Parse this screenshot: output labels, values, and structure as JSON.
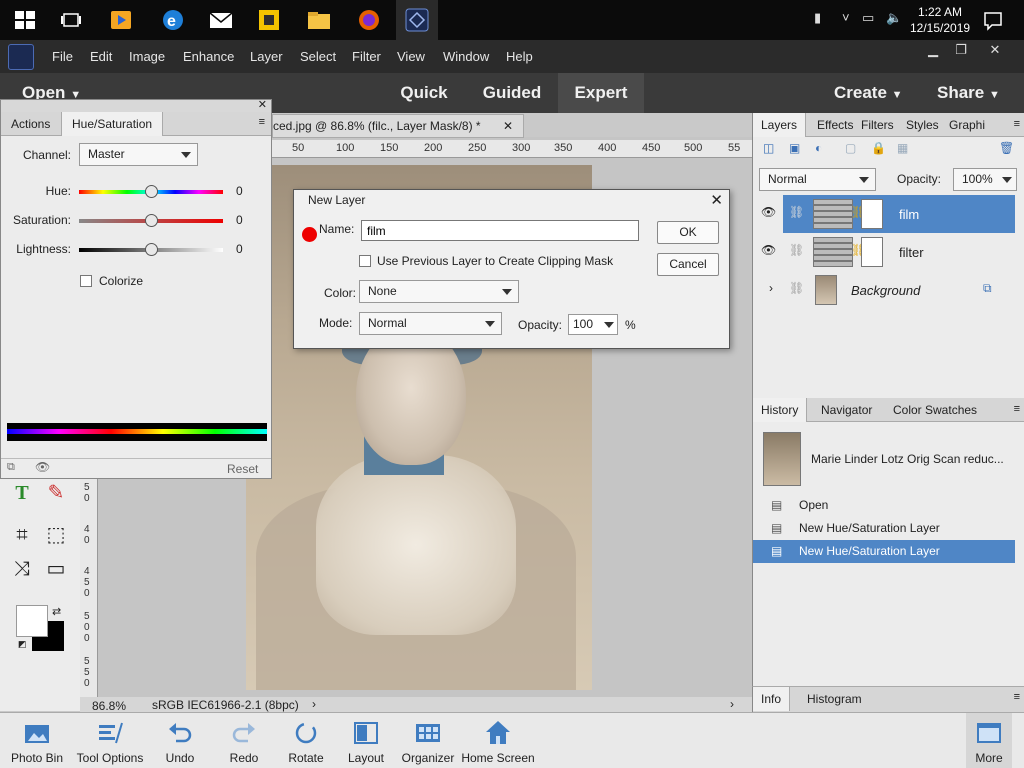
{
  "taskbar": {
    "time": "1:22 AM",
    "date": "12/15/2019"
  },
  "menubar": {
    "items": [
      "File",
      "Edit",
      "Image",
      "Enhance",
      "Layer",
      "Select",
      "Filter",
      "View",
      "Window",
      "Help"
    ],
    "minimize": "▁",
    "restore": "❐",
    "close": "✕"
  },
  "modebar": {
    "open_label": "Open",
    "tabs": [
      "Quick",
      "Guided",
      "Expert"
    ],
    "create_label": "Create",
    "share_label": "Share"
  },
  "document": {
    "tab_title": "ced.jpg @ 86.8% (filc., Layer Mask/8) *",
    "zoom": "86.8%",
    "color_profile": "sRGB IEC61966-2.1 (8bpc)",
    "ruler_top": [
      "50",
      "100",
      "150",
      "200",
      "250",
      "300",
      "350",
      "400",
      "450",
      "500",
      "55"
    ],
    "ruler_left": [
      "5",
      "0",
      "4",
      "0",
      "4",
      "5",
      "0",
      "5",
      "0",
      "0",
      "5",
      "5",
      "0",
      "6"
    ]
  },
  "hue_sat": {
    "tab_actions": "Actions",
    "tab_active": "Hue/Saturation",
    "channel_label": "Channel:",
    "channel_value": "Master",
    "hue_label": "Hue:",
    "hue_value": "0",
    "saturation_label": "Saturation:",
    "saturation_value": "0",
    "lightness_label": "Lightness:",
    "lightness_value": "0",
    "colorize_label": "Colorize",
    "reset_label": "Reset",
    "slider_position": 0.5
  },
  "layers": {
    "tabs": [
      "Layers",
      "Effects",
      "Filters",
      "Styles",
      "Graphi"
    ],
    "blend_mode": "Normal",
    "opacity_label": "Opacity:",
    "opacity_value": "100%",
    "rows": [
      {
        "name": "film"
      },
      {
        "name": "filter"
      },
      {
        "name": "Background"
      }
    ]
  },
  "history": {
    "tabs": [
      "History",
      "Navigator",
      "Color Swatches"
    ],
    "snapshot_name": "Marie Linder Lotz Orig Scan reduc...",
    "items": [
      "Open",
      "New Hue/Saturation Layer",
      "New Hue/Saturation Layer"
    ]
  },
  "info": {
    "tabs": [
      "Info",
      "Histogram"
    ]
  },
  "bottombar": {
    "items": [
      "Photo Bin",
      "Tool Options",
      "Undo",
      "Redo",
      "Rotate",
      "Layout",
      "Organizer",
      "Home Screen"
    ],
    "more_label": "More"
  },
  "dialog": {
    "title": "New Layer",
    "name_label": "Name:",
    "name_value": "film",
    "clipping_label": "Use Previous Layer to Create Clipping Mask",
    "color_label": "Color:",
    "color_value": "None",
    "mode_label": "Mode:",
    "mode_value": "Normal",
    "opacity_label": "Opacity:",
    "opacity_value": "100",
    "percent": "%",
    "ok_label": "OK",
    "cancel_label": "Cancel"
  },
  "colors": {
    "selection": "#4f86c6",
    "taskbar": "#0b0b0b",
    "menubar": "#2b2b2b"
  }
}
